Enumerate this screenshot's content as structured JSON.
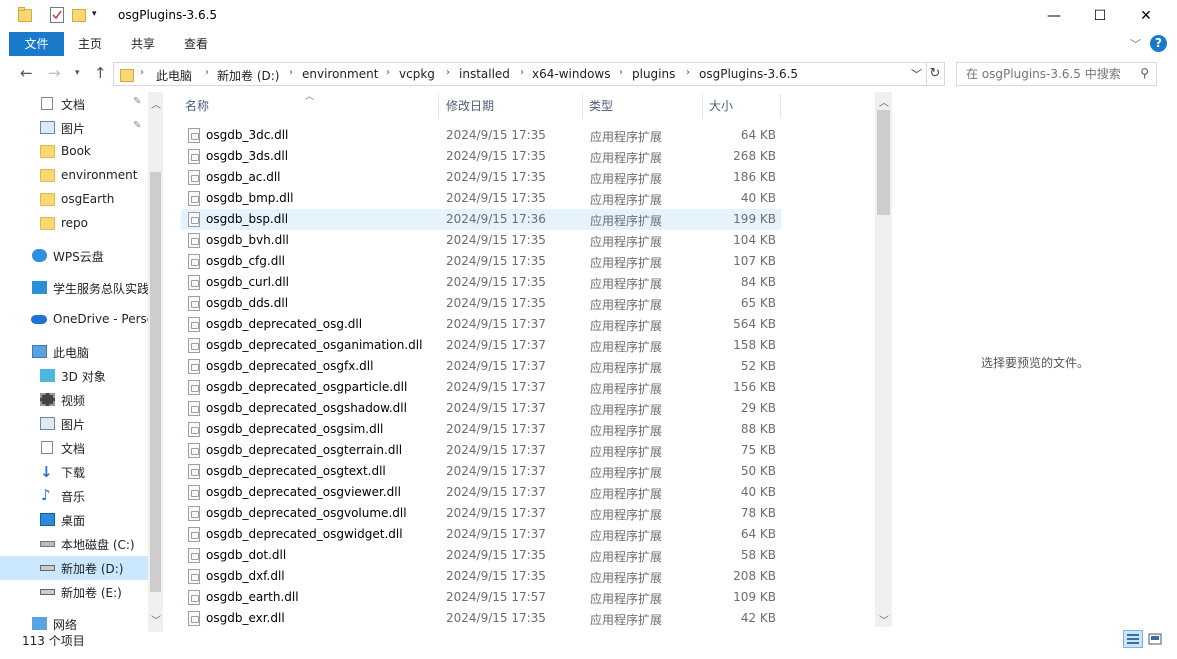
{
  "window": {
    "title": "osgPlugins-3.6.5",
    "minimize": "—",
    "maximize": "☐",
    "close": "✕"
  },
  "ribbon": {
    "tabs": [
      {
        "label": "文件",
        "active": true
      },
      {
        "label": "主页"
      },
      {
        "label": "共享"
      },
      {
        "label": "查看"
      }
    ],
    "help": "?"
  },
  "address": {
    "crumbs": [
      "此电脑",
      "新加卷 (D:)",
      "environment",
      "vcpkg",
      "installed",
      "x64-windows",
      "plugins",
      "osgPlugins-3.6.5"
    ]
  },
  "search": {
    "placeholder": "在 osgPlugins-3.6.5 中搜索"
  },
  "nav": {
    "items": [
      {
        "label": "文档",
        "icon": "documents-icon",
        "pinned": true
      },
      {
        "label": "图片",
        "icon": "pictures-icon",
        "pinned": true
      },
      {
        "label": "Book",
        "icon": "folder-icon"
      },
      {
        "label": "environment",
        "icon": "folder-icon"
      },
      {
        "label": "osgEarth",
        "icon": "folder-icon"
      },
      {
        "label": "repo",
        "icon": "folder-icon"
      },
      {
        "label": "WPS云盘",
        "icon": "wps-cloud-icon"
      },
      {
        "label": "学生服务总队实践",
        "icon": "cloud-drive-icon"
      },
      {
        "label": "OneDrive - Perso",
        "icon": "onedrive-icon"
      },
      {
        "label": "此电脑",
        "icon": "this-pc-icon"
      },
      {
        "label": "3D 对象",
        "icon": "3d-objects-icon"
      },
      {
        "label": "视频",
        "icon": "videos-icon"
      },
      {
        "label": "图片",
        "icon": "pictures-icon"
      },
      {
        "label": "文档",
        "icon": "documents-icon"
      },
      {
        "label": "下载",
        "icon": "downloads-icon"
      },
      {
        "label": "音乐",
        "icon": "music-icon"
      },
      {
        "label": "桌面",
        "icon": "desktop-icon"
      },
      {
        "label": "本地磁盘 (C:)",
        "icon": "system-drive-icon"
      },
      {
        "label": "新加卷 (D:)",
        "icon": "drive-icon",
        "selected": true
      },
      {
        "label": "新加卷 (E:)",
        "icon": "drive-icon"
      },
      {
        "label": "网络",
        "icon": "network-icon"
      }
    ]
  },
  "columns": {
    "name": "名称",
    "date": "修改日期",
    "type": "类型",
    "size": "大小"
  },
  "files": [
    {
      "name": "osgdb_3dc.dll",
      "date": "2024/9/15 17:35",
      "type": "应用程序扩展",
      "size": "64 KB"
    },
    {
      "name": "osgdb_3ds.dll",
      "date": "2024/9/15 17:35",
      "type": "应用程序扩展",
      "size": "268 KB"
    },
    {
      "name": "osgdb_ac.dll",
      "date": "2024/9/15 17:35",
      "type": "应用程序扩展",
      "size": "186 KB"
    },
    {
      "name": "osgdb_bmp.dll",
      "date": "2024/9/15 17:35",
      "type": "应用程序扩展",
      "size": "40 KB"
    },
    {
      "name": "osgdb_bsp.dll",
      "date": "2024/9/15 17:36",
      "type": "应用程序扩展",
      "size": "199 KB",
      "hover": true
    },
    {
      "name": "osgdb_bvh.dll",
      "date": "2024/9/15 17:35",
      "type": "应用程序扩展",
      "size": "104 KB"
    },
    {
      "name": "osgdb_cfg.dll",
      "date": "2024/9/15 17:35",
      "type": "应用程序扩展",
      "size": "107 KB"
    },
    {
      "name": "osgdb_curl.dll",
      "date": "2024/9/15 17:35",
      "type": "应用程序扩展",
      "size": "84 KB"
    },
    {
      "name": "osgdb_dds.dll",
      "date": "2024/9/15 17:35",
      "type": "应用程序扩展",
      "size": "65 KB"
    },
    {
      "name": "osgdb_deprecated_osg.dll",
      "date": "2024/9/15 17:37",
      "type": "应用程序扩展",
      "size": "564 KB"
    },
    {
      "name": "osgdb_deprecated_osganimation.dll",
      "date": "2024/9/15 17:37",
      "type": "应用程序扩展",
      "size": "158 KB"
    },
    {
      "name": "osgdb_deprecated_osgfx.dll",
      "date": "2024/9/15 17:37",
      "type": "应用程序扩展",
      "size": "52 KB"
    },
    {
      "name": "osgdb_deprecated_osgparticle.dll",
      "date": "2024/9/15 17:37",
      "type": "应用程序扩展",
      "size": "156 KB"
    },
    {
      "name": "osgdb_deprecated_osgshadow.dll",
      "date": "2024/9/15 17:37",
      "type": "应用程序扩展",
      "size": "29 KB"
    },
    {
      "name": "osgdb_deprecated_osgsim.dll",
      "date": "2024/9/15 17:37",
      "type": "应用程序扩展",
      "size": "88 KB"
    },
    {
      "name": "osgdb_deprecated_osgterrain.dll",
      "date": "2024/9/15 17:37",
      "type": "应用程序扩展",
      "size": "75 KB"
    },
    {
      "name": "osgdb_deprecated_osgtext.dll",
      "date": "2024/9/15 17:37",
      "type": "应用程序扩展",
      "size": "50 KB"
    },
    {
      "name": "osgdb_deprecated_osgviewer.dll",
      "date": "2024/9/15 17:37",
      "type": "应用程序扩展",
      "size": "40 KB"
    },
    {
      "name": "osgdb_deprecated_osgvolume.dll",
      "date": "2024/9/15 17:37",
      "type": "应用程序扩展",
      "size": "78 KB"
    },
    {
      "name": "osgdb_deprecated_osgwidget.dll",
      "date": "2024/9/15 17:37",
      "type": "应用程序扩展",
      "size": "64 KB"
    },
    {
      "name": "osgdb_dot.dll",
      "date": "2024/9/15 17:35",
      "type": "应用程序扩展",
      "size": "58 KB"
    },
    {
      "name": "osgdb_dxf.dll",
      "date": "2024/9/15 17:35",
      "type": "应用程序扩展",
      "size": "208 KB"
    },
    {
      "name": "osgdb_earth.dll",
      "date": "2024/9/15 17:57",
      "type": "应用程序扩展",
      "size": "109 KB"
    },
    {
      "name": "osgdb_exr.dll",
      "date": "2024/9/15 17:35",
      "type": "应用程序扩展",
      "size": "42 KB"
    }
  ],
  "preview": {
    "message": "选择要预览的文件。"
  },
  "status": {
    "count": "113 个项目"
  },
  "colors": {
    "accent": "#1979ca",
    "selection": "#cce8ff",
    "hover": "#e5f3ff"
  }
}
